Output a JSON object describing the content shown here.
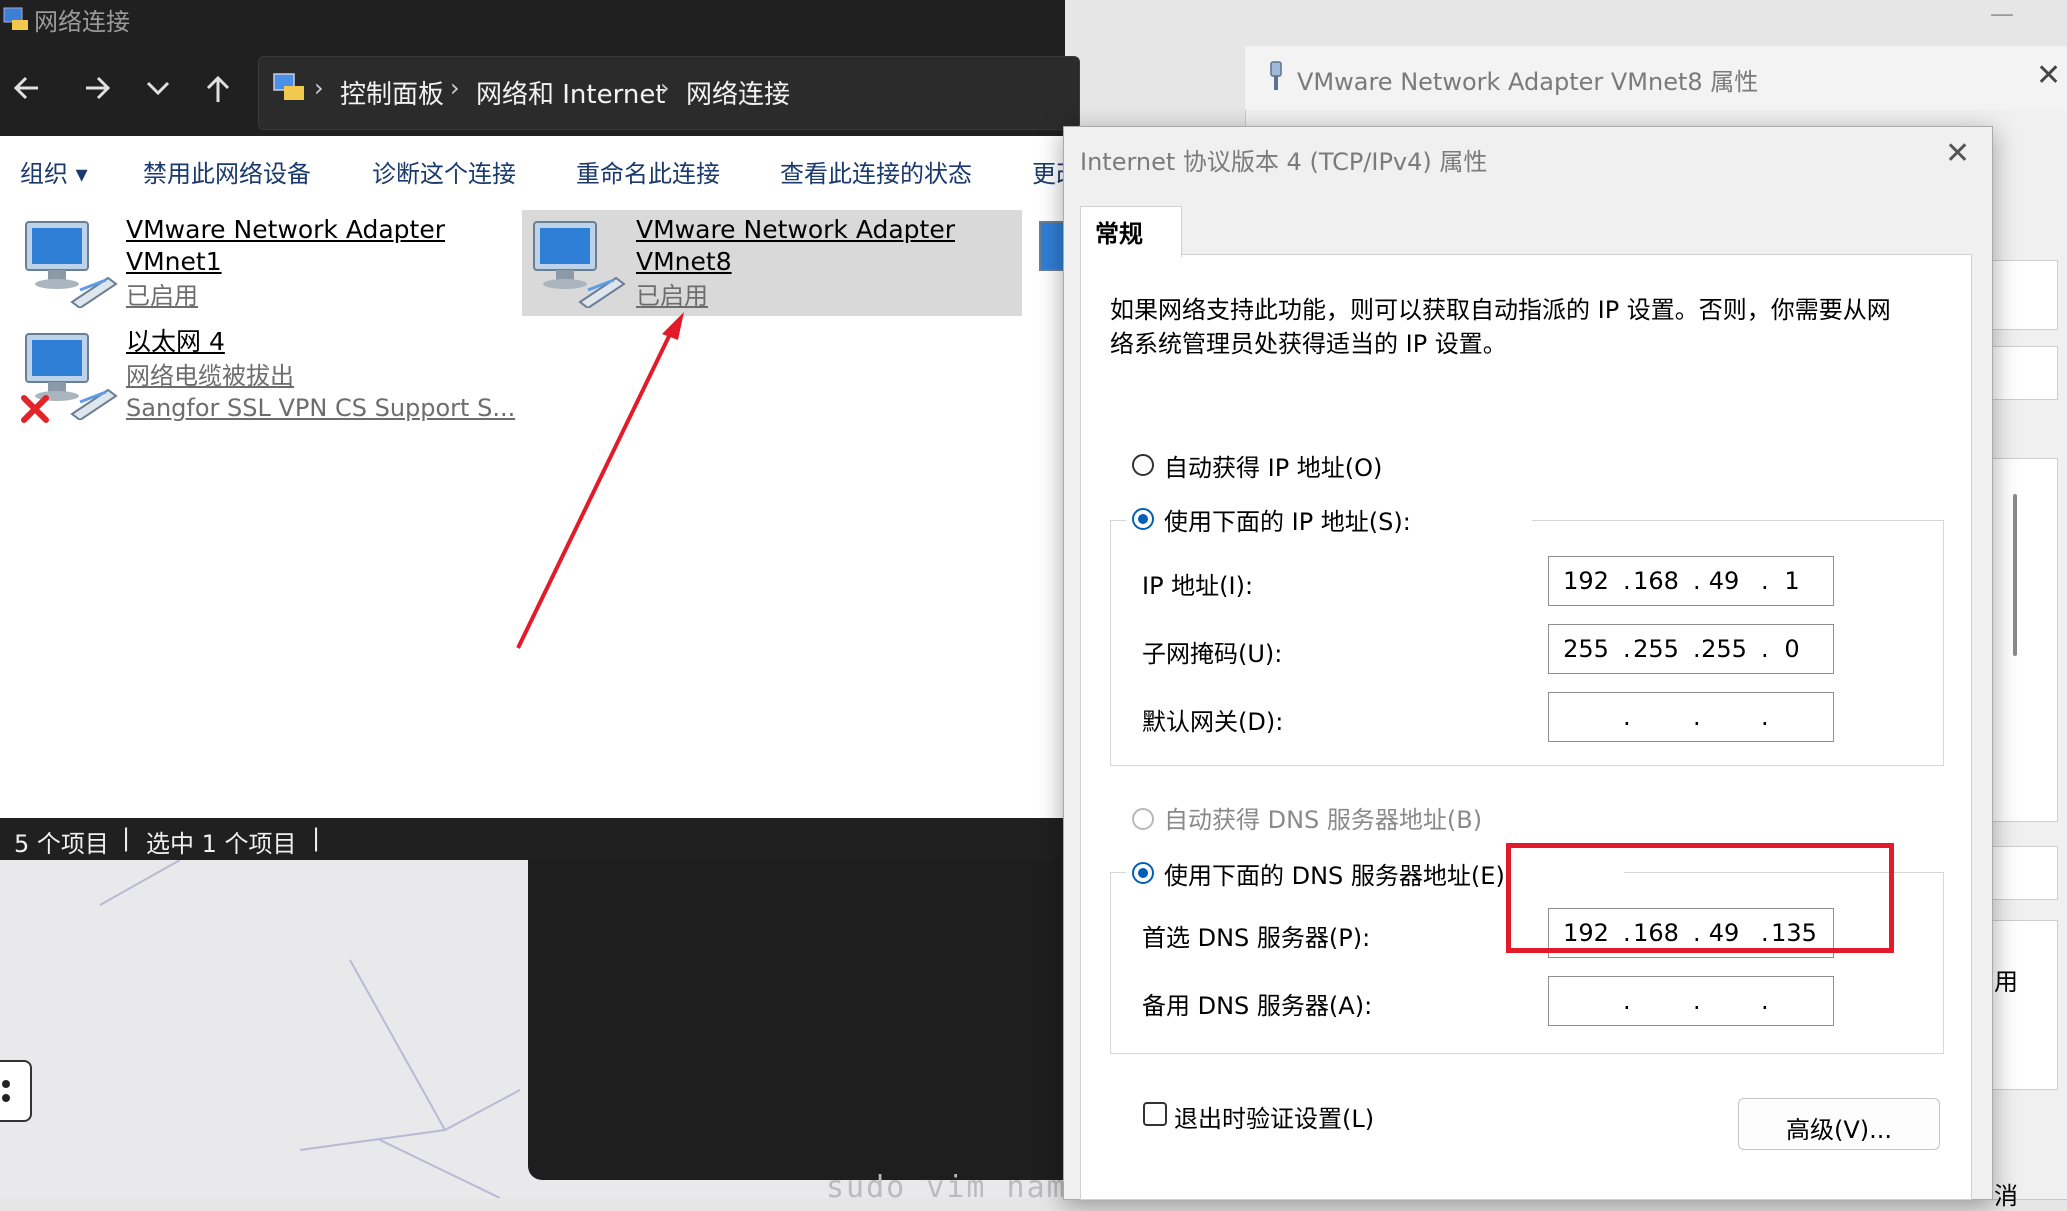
{
  "explorer": {
    "window_title": "网络连接",
    "breadcrumb": [
      "控制面板",
      "网络和 Internet",
      "网络连接"
    ],
    "breadcrumb_sep": "›",
    "toolbar": [
      "组织 ▾",
      "禁用此网络设备",
      "诊断这个连接",
      "重命名此连接",
      "查看此连接的状态",
      "更改"
    ],
    "items": [
      {
        "name_line1": "VMware Network Adapter",
        "name_line2": "VMnet1",
        "status": "已启用",
        "selected": false
      },
      {
        "name_line1": "VMware Network Adapter",
        "name_line2": "VMnet8",
        "status": "已启用",
        "selected": true
      },
      {
        "name_line1": "以太网 4",
        "status": "网络电缆被拔出",
        "device": "Sangfor SSL VPN CS Support S...",
        "disconnected": true
      }
    ],
    "statusbar": {
      "count": "5 个项目",
      "selected": "选中 1 个项目"
    }
  },
  "adapter_window": {
    "title": "VMware Network Adapter VMnet8 属性",
    "fragments": [
      "用",
      "消"
    ]
  },
  "tcp_dialog": {
    "title": "Internet 协议版本 4 (TCP/IPv4) 属性",
    "tab": "常规",
    "description": [
      "如果网络支持此功能，则可以获取自动指派的 IP 设置。否则，你需要从网",
      "络系统管理员处获得适当的 IP 设置。"
    ],
    "auto_ip": "自动获得 IP 地址(O)",
    "manual_ip": "使用下面的 IP 地址(S):",
    "ip_label": "IP 地址(I):",
    "ip": [
      "192",
      "168",
      "49",
      "1"
    ],
    "subnet_label": "子网掩码(U):",
    "subnet": [
      "255",
      "255",
      "255",
      "0"
    ],
    "gateway_label": "默认网关(D):",
    "gateway": [
      "",
      "",
      "",
      ""
    ],
    "auto_dns": "自动获得 DNS 服务器地址(B)",
    "manual_dns": "使用下面的 DNS 服务器地址(E):",
    "dns1_label": "首选 DNS 服务器(P):",
    "dns1": [
      "192",
      "168",
      "49",
      "135"
    ],
    "dns2_label": "备用 DNS 服务器(A):",
    "dns2": [
      "",
      "",
      "",
      ""
    ],
    "validate_label": "退出时验证设置(L)",
    "advanced_label": "高级(V)...",
    "close_glyph": "✕"
  },
  "terminal": {
    "text": "sudo vim nam"
  },
  "colors": {
    "annotation_red": "#e21a2a",
    "radio_blue": "#005fb8",
    "dark_chrome": "#202020"
  }
}
